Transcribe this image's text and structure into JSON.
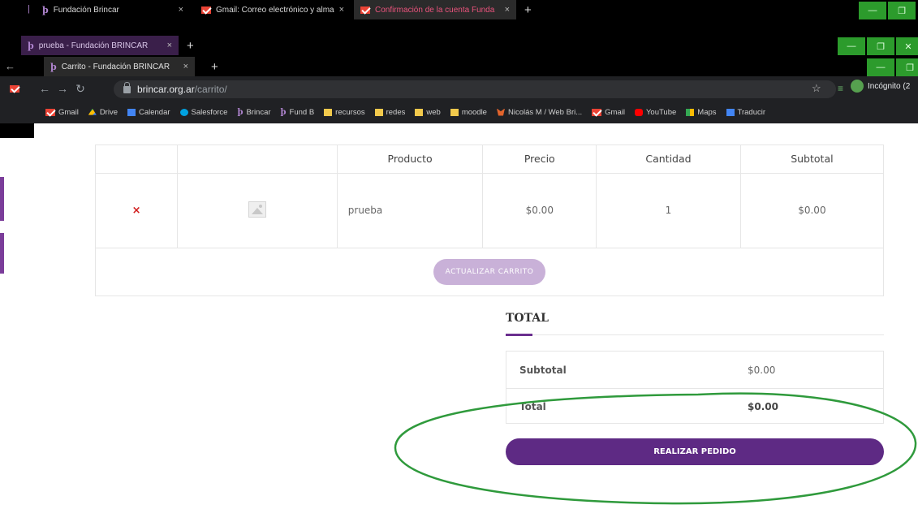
{
  "browser": {
    "windows": [
      {
        "tabs": [
          {
            "title": "Fundación Brincar",
            "icon": "brincar-b-icon"
          },
          {
            "title": "Gmail: Correo electrónico y alma",
            "icon": "gmail-icon"
          },
          {
            "title": "Confirmación de la cuenta Funda",
            "icon": "gmail-icon",
            "active": true
          }
        ]
      },
      {
        "tabs": [
          {
            "title": "prueba - Fundación BRINCAR",
            "icon": "brincar-b-icon"
          }
        ]
      },
      {
        "tabs": [
          {
            "title": "Carrito - Fundación BRINCAR",
            "icon": "brincar-b-icon"
          }
        ]
      }
    ],
    "new_tab": "+",
    "close_glyph": "×",
    "window_controls": {
      "minimize": "—",
      "restore": "❐",
      "close": "✕"
    },
    "address": {
      "host": "brincar.org.ar",
      "path": "/carrito/"
    },
    "profile_label": "Incógnito (2",
    "bookmarks": [
      {
        "label": "Gmail",
        "icon": "gmail-icon"
      },
      {
        "label": "Drive",
        "icon": "drive-icon"
      },
      {
        "label": "Calendar",
        "icon": "calendar-icon"
      },
      {
        "label": "Salesforce",
        "icon": "salesforce-icon"
      },
      {
        "label": "Brincar",
        "icon": "brincar-b-icon"
      },
      {
        "label": "Fund B",
        "icon": "brincar-b-icon"
      },
      {
        "label": "recursos",
        "icon": "folder-icon"
      },
      {
        "label": "redes",
        "icon": "folder-icon"
      },
      {
        "label": "web",
        "icon": "folder-icon"
      },
      {
        "label": "moodle",
        "icon": "folder-icon"
      },
      {
        "label": "Nicolás M / Web Bri...",
        "icon": "gitlab-icon"
      },
      {
        "label": "Gmail",
        "icon": "gmail-icon"
      },
      {
        "label": "YouTube",
        "icon": "youtube-icon"
      },
      {
        "label": "Maps",
        "icon": "maps-icon"
      },
      {
        "label": "Traducir",
        "icon": "translate-icon"
      }
    ]
  },
  "cart": {
    "headers": {
      "product": "Producto",
      "price": "Precio",
      "quantity": "Cantidad",
      "subtotal": "Subtotal"
    },
    "items": [
      {
        "remove": "×",
        "name": "prueba",
        "price": "$0.00",
        "quantity": "1",
        "subtotal": "$0.00"
      }
    ],
    "update_label": "ACTUALIZAR CARRITO"
  },
  "totals": {
    "title": "TOTAL",
    "subtotal_label": "Subtotal",
    "subtotal_value": "$0.00",
    "total_label": "Total",
    "total_value": "$0.00",
    "checkout_label": "REALIZAR PEDIDO"
  },
  "colors": {
    "brand_purple": "#5e2a84",
    "link_purple": "#7a4a9c",
    "update_button_disabled": "#c9b1d8",
    "remove_red": "#d11c1c",
    "annotation_green": "#2f9a3c",
    "window_control_green": "#2c9b2c"
  }
}
